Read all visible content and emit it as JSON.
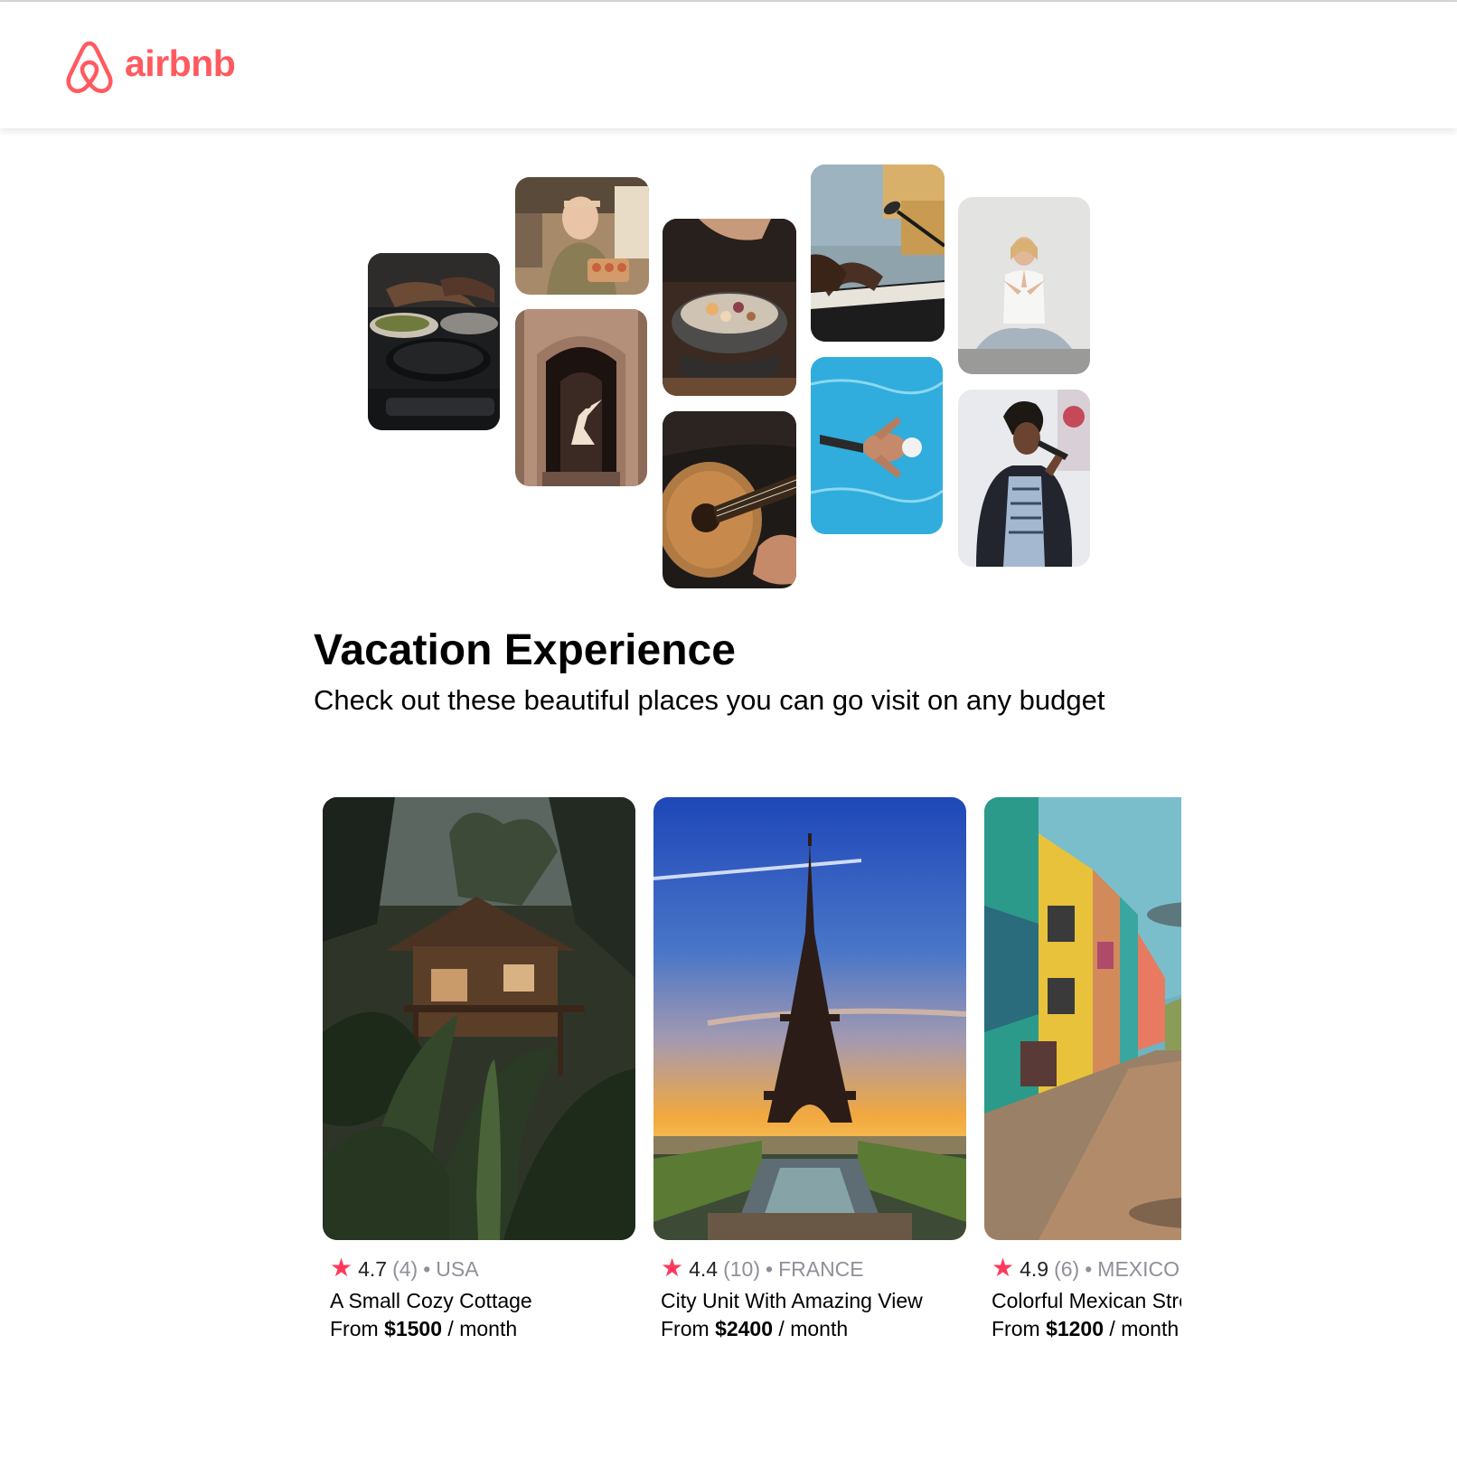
{
  "navbar": {
    "logo_text": "airbnb",
    "brand_color": "#ff5a5f"
  },
  "hero": {
    "title": "Vacation Experience",
    "subtitle": "Check out these beautiful places you can go visit on any budget",
    "photos": [
      {
        "name": "cooking-hands"
      },
      {
        "name": "woman-baker"
      },
      {
        "name": "dancer-doorway"
      },
      {
        "name": "salt-bowl"
      },
      {
        "name": "guitar-player"
      },
      {
        "name": "piano-microphone"
      },
      {
        "name": "swimmer-pool"
      },
      {
        "name": "yoga-woman"
      },
      {
        "name": "singer-microphone"
      }
    ]
  },
  "cards": [
    {
      "star_icon": "star-icon",
      "rating": "4.7",
      "reviews": "(4)",
      "separator": "•",
      "location": "USA",
      "title": "A Small Cozy Cottage",
      "price_prefix": "From ",
      "price": "$1500",
      "price_suffix": " / month"
    },
    {
      "star_icon": "star-icon",
      "rating": "4.4",
      "reviews": "(10)",
      "separator": "•",
      "location": "FRANCE",
      "title": "City Unit With Amazing View",
      "price_prefix": "From ",
      "price": "$2400",
      "price_suffix": " / month"
    },
    {
      "star_icon": "star-icon",
      "rating": "4.9",
      "reviews": "(6)",
      "separator": "•",
      "location": "MEXICO",
      "title": "Colorful Mexican Street",
      "price_prefix": "From ",
      "price": "$1200",
      "price_suffix": " / month"
    }
  ],
  "colors": {
    "star": "#fe395c",
    "muted_text": "#918e9b"
  }
}
